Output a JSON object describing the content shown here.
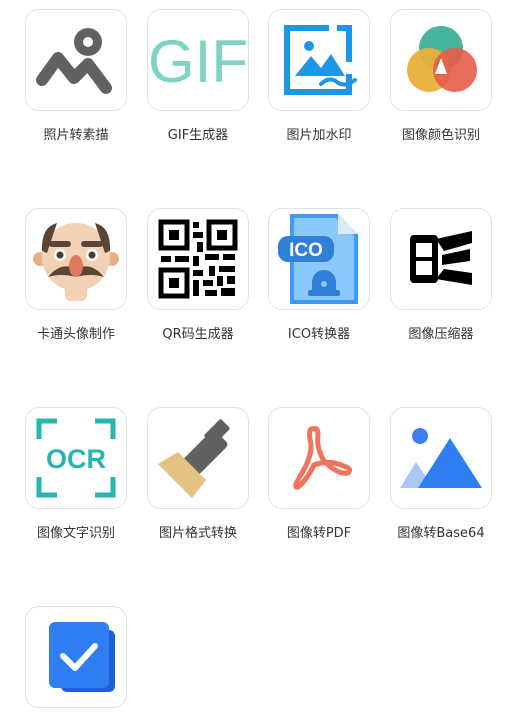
{
  "tools": [
    {
      "label": "照片转素描",
      "icon": "photo-sketch-icon"
    },
    {
      "label": "GIF生成器",
      "icon": "gif-icon"
    },
    {
      "label": "图片加水印",
      "icon": "watermark-icon"
    },
    {
      "label": "图像颜色识别",
      "icon": "color-recognition-icon"
    },
    {
      "label": "卡通头像制作",
      "icon": "cartoon-avatar-icon"
    },
    {
      "label": "QR码生成器",
      "icon": "qr-code-icon"
    },
    {
      "label": "ICO转换器",
      "icon": "ico-file-icon"
    },
    {
      "label": "图像压缩器",
      "icon": "image-compress-icon"
    },
    {
      "label": "图像文字识别",
      "icon": "ocr-icon"
    },
    {
      "label": "图片格式转换",
      "icon": "brush-icon"
    },
    {
      "label": "图像转PDF",
      "icon": "pdf-icon"
    },
    {
      "label": "图像转Base64",
      "icon": "image-base64-icon"
    },
    {
      "label": "",
      "icon": "checkmark-card-icon"
    }
  ],
  "gif_text": "GIF",
  "ico_text": "ICO",
  "ocr_text": "OCR"
}
